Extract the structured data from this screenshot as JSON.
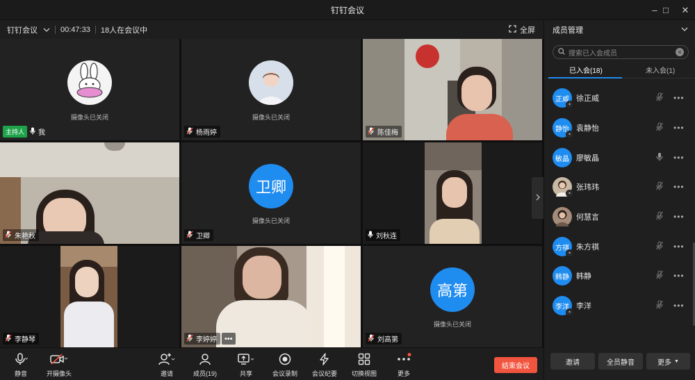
{
  "window": {
    "title": "钉钉会议",
    "minimize": "–",
    "maximize": "□",
    "close": "✕"
  },
  "infobar": {
    "meeting_name": "钉钉会议",
    "duration": "00:47:33",
    "attendee_count": "18人在会议中",
    "fullscreen": "全屏"
  },
  "tiles": [
    {
      "name": "我",
      "badge": "主持人",
      "status": "摄像头已关闭"
    },
    {
      "name": "杨雨婷",
      "status": "摄像头已关闭"
    },
    {
      "name": "陈佳梅"
    },
    {
      "name": "朱艳秋"
    },
    {
      "name": "卫卿",
      "avatar_text": "卫卿",
      "status": "摄像头已关闭"
    },
    {
      "name": "刘秋连"
    },
    {
      "name": "李静琴"
    },
    {
      "name": "李婷婷",
      "more": "•••"
    },
    {
      "name": "刘高第",
      "avatar_text": "高第",
      "status": "摄像头已关闭"
    }
  ],
  "toolbar": {
    "mute": "静音",
    "camera": "开摄像头",
    "invite": "邀请",
    "members": "成员(19)",
    "share": "共享",
    "record": "会议录制",
    "minutes": "会议纪要",
    "switch_view": "切换视图",
    "more": "更多",
    "end_meeting": "结束会议"
  },
  "panel": {
    "title": "成员管理",
    "search_placeholder": "搜索已入会成员",
    "tab_joined": "已入会(18)",
    "tab_not_joined": "未入会(1)",
    "members": [
      {
        "avatar": "正威",
        "name": "徐正威"
      },
      {
        "avatar": "静怡",
        "name": "袁静怡"
      },
      {
        "avatar": "敏晶",
        "name": "廖敏晶"
      },
      {
        "avatar": "",
        "name": "张玮玮"
      },
      {
        "avatar": "",
        "name": "何慧言"
      },
      {
        "avatar": "方祺",
        "name": "朱方祺"
      },
      {
        "avatar": "韩静",
        "name": "韩静"
      },
      {
        "avatar": "李洋",
        "name": "李洋"
      }
    ],
    "btn_invite": "邀请",
    "btn_mute_all": "全员静音",
    "btn_more": "更多"
  },
  "colors": {
    "accent": "#1f8cf0",
    "host_badge": "#1fa34a",
    "end_button": "#f2553f"
  }
}
